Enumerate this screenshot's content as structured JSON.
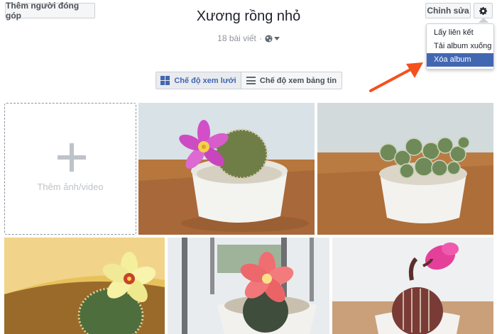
{
  "header": {
    "add_contributors_label": "Thêm người đóng góp",
    "album_title": "Xương rồng nhỏ",
    "post_count": "18 bài viết",
    "separator": "·",
    "edit_label": "Chỉnh sửa"
  },
  "settings_menu": {
    "items": [
      {
        "label": "Lấy liên kết"
      },
      {
        "label": "Tải album xuống"
      },
      {
        "label": "Xóa album"
      }
    ],
    "highlighted_index": 2
  },
  "view_toggle": {
    "grid_label": "Chế độ xem lưới",
    "feed_label": "Chế độ xem bảng tin",
    "selected": "grid"
  },
  "grid": {
    "add_tile_label": "Thêm ảnh/video"
  },
  "colors": {
    "accent": "#4267b2",
    "annotation_arrow": "#f4511e"
  },
  "icons": {
    "settings": "gear-icon",
    "privacy": "globe-icon",
    "dropdown": "caret-down-icon",
    "grid_view": "grid-icon",
    "feed_view": "list-icon",
    "add": "plus-icon"
  }
}
